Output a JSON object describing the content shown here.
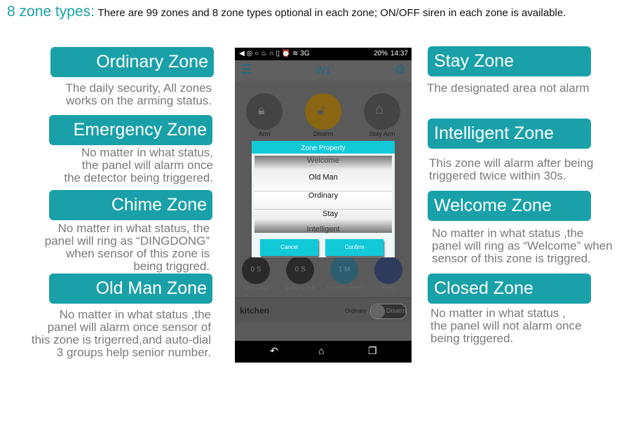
{
  "header": {
    "title": "8 zone types:",
    "subtitle": "There are 99 zones and 8 zone types optional in each zone; ON/OFF siren in each zone is available."
  },
  "zones_left": [
    {
      "name": "Ordinary Zone",
      "desc": "The daily security, All zones\nworks on the arming status."
    },
    {
      "name": "Emergency Zone",
      "desc": "No matter in what status,\nthe panel will alarm once\nthe detector being triggered."
    },
    {
      "name": "Chime Zone",
      "desc": "No matter in what status, the\npanel will ring as “DINGDONG”\nwhen sensor of this zone is\nbeing triggred."
    },
    {
      "name": "Old Man Zone",
      "desc": "No matter in what status ,the\npanel will alarm once sensor of\nthis zone  is trigerred,and auto-dial\n3 groups  help senior number."
    }
  ],
  "zones_right": [
    {
      "name": "Stay Zone",
      "desc": "The designated area not alarm"
    },
    {
      "name": "Intelligent Zone",
      "desc": "This zone will alarm after being\ntriggered twice within 30s."
    },
    {
      "name": "Welcome Zone",
      "desc": "No matter in what status ,the\npanel will ring as “Welcome” when\nsensor of this zone is triggred."
    },
    {
      "name": "Closed Zone",
      "desc": "No matter in what status ,\n the panel will not alarm once\n being triggered."
    }
  ],
  "phone": {
    "status": {
      "battery": "20%",
      "time": "14:37"
    },
    "app_title": "W1",
    "modes": [
      "Arm",
      "Disarm",
      "Stay Arm"
    ],
    "settings": [
      {
        "value": "0 S",
        "label": "delay arm"
      },
      {
        "value": "0 S",
        "label": "delay alarm"
      },
      {
        "value": "1 M",
        "label": "AlarmDuration"
      },
      {
        "value": "",
        "label": "Parts"
      }
    ],
    "room": {
      "name": "kitchen",
      "type": "Ordinary",
      "state": "Disarm"
    },
    "dialog": {
      "title": "Zone Property",
      "options": [
        "Welcome",
        "Old Man",
        "Ordinary",
        "Stay",
        "Intelligent"
      ],
      "cancel": "Cancel",
      "confirm": "Confirm"
    }
  },
  "colors": {
    "accent": "#1aa0a8",
    "dialog": "#12c9d8",
    "disarm": "#d4950a"
  }
}
